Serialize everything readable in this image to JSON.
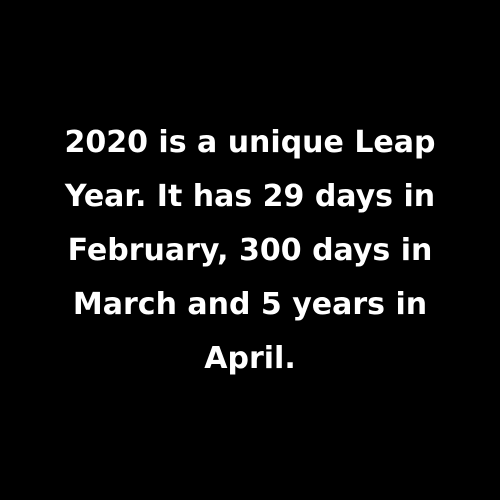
{
  "colors": {
    "background": "#000000",
    "text": "#ffffff"
  },
  "caption": {
    "lines": [
      "2020 is a unique Leap",
      "Year. It has 29 days in",
      "February, 300 days in",
      "March and 5 years in",
      "April."
    ]
  }
}
